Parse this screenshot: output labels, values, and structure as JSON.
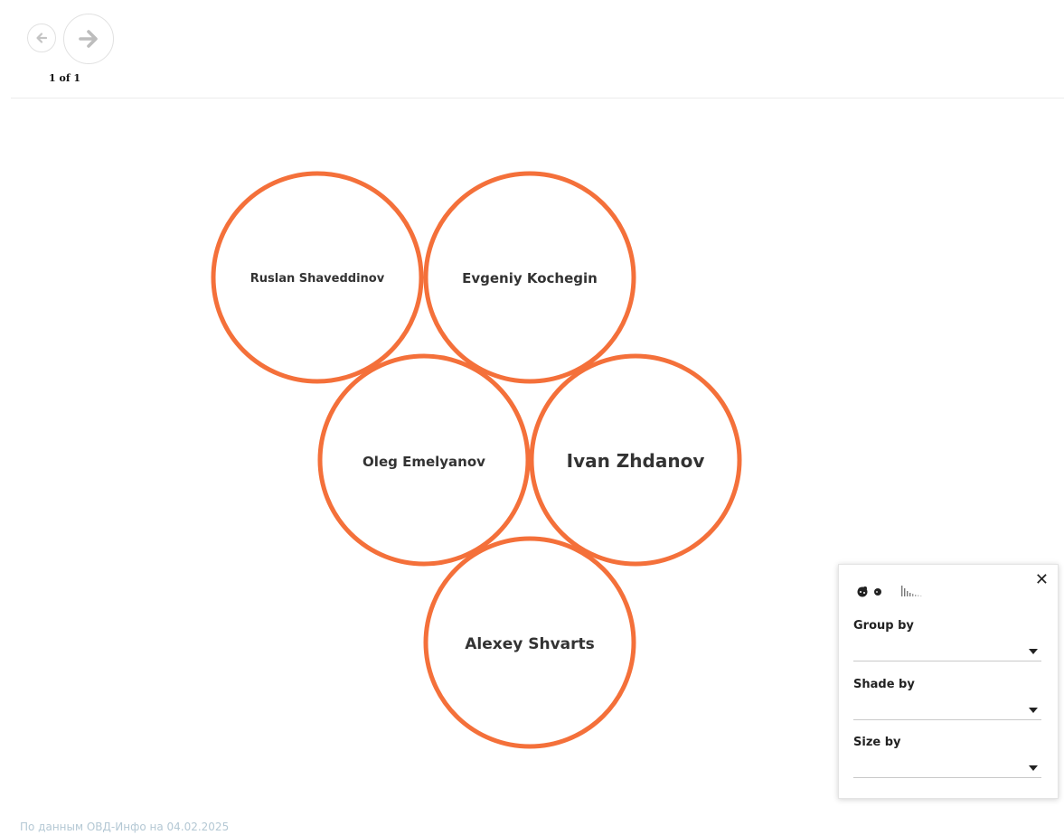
{
  "pager": {
    "count_text": "1 of 1",
    "prev_icon": "arrow-left-icon",
    "next_icon": "arrow-right-icon"
  },
  "bubbles": [
    {
      "label": "Ruslan Shaveddinov"
    },
    {
      "label": "Evgeniy Kochegin"
    },
    {
      "label": "Oleg Emelyanov"
    },
    {
      "label": "Ivan Zhdanov"
    },
    {
      "label": "Alexey Shvarts"
    }
  ],
  "panel": {
    "close_label": "✕",
    "view_icons": [
      "bubbles-view-icon",
      "bars-view-icon"
    ],
    "group_by": {
      "label": "Group by",
      "value": ""
    },
    "shade_by": {
      "label": "Shade by",
      "value": ""
    },
    "size_by": {
      "label": "Size by",
      "value": ""
    }
  },
  "footer": {
    "note": "По данным ОВД-Инфо на 04.02.2025"
  },
  "colors": {
    "bubble_stroke": "#f4703a",
    "bubble_fill": "#ffffff",
    "label_text": "#333333",
    "footer_text": "#b4c8d4"
  }
}
